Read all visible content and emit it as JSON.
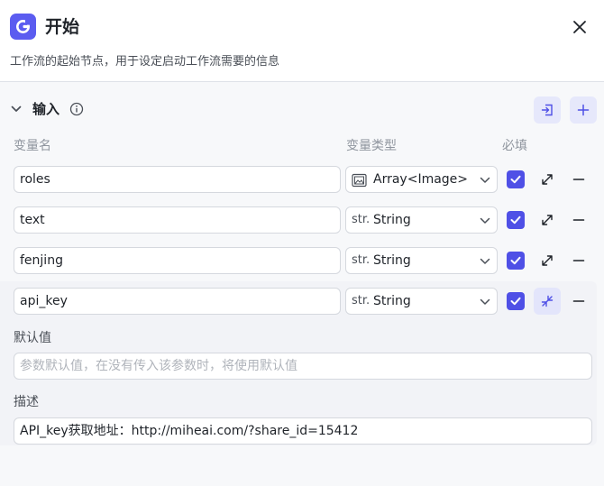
{
  "header": {
    "title": "开始",
    "description": "工作流的起始节点，用于设定启动工作流需要的信息"
  },
  "section": {
    "title": "输入"
  },
  "columns": {
    "name": "变量名",
    "type": "变量类型",
    "required": "必填"
  },
  "rows": [
    {
      "name": "roles",
      "type": "Array<Image>",
      "type_icon": "image-icon",
      "required": true
    },
    {
      "name": "text",
      "type": "String",
      "type_icon": "str.",
      "required": true
    },
    {
      "name": "fenjing",
      "type": "String",
      "type_icon": "str.",
      "required": true
    },
    {
      "name": "api_key",
      "type": "String",
      "type_icon": "str.",
      "required": true
    }
  ],
  "expanded": {
    "default_label": "默认值",
    "default_placeholder": "参数默认值，在没有传入该参数时，将使用默认值",
    "desc_label": "描述",
    "desc_value": "API_key获取地址：http://miheai.com/?share_id=15412"
  },
  "colors": {
    "accent": "#5b5cf0",
    "checkbox": "#4f50e6",
    "button_bg": "#e6e8fb"
  }
}
